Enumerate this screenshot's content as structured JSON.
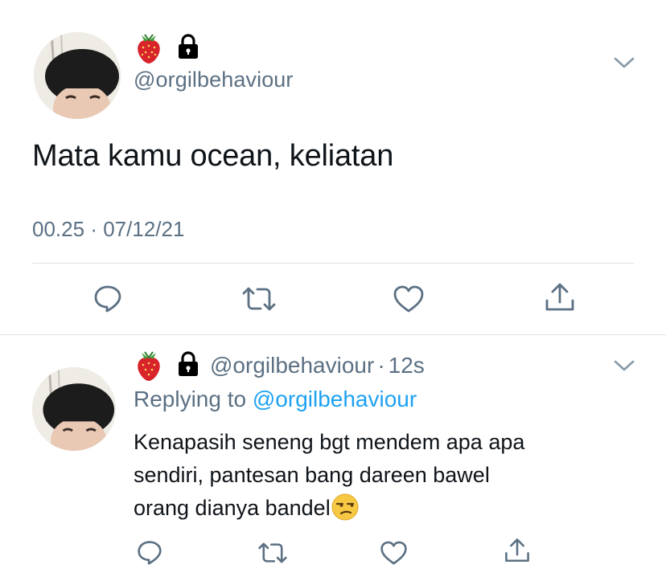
{
  "main_tweet": {
    "handle": "@orgilbehaviour",
    "text": "Mata kamu ocean, keliatan",
    "time": "00.25",
    "separator": "·",
    "date": "07/12/21"
  },
  "reply_tweet": {
    "handle": "@orgilbehaviour",
    "separator": "·",
    "age": "12s",
    "replying_prefix": "Replying to",
    "replying_to": "@orgilbehaviour",
    "text_lines": [
      "Kenapasih seneng bgt mendem apa apa",
      "sendiri, pantesan bang dareen bawel",
      "orang dianya bandel"
    ],
    "trailing_emoji": "unamused-face-emoji"
  },
  "icons": {
    "name_emoji": "strawberry-emoji",
    "protected": "lock-icon",
    "menu": "chevron-down-icon",
    "reply": "reply-bubble-icon",
    "retweet": "retweet-icon",
    "like": "heart-icon",
    "share": "share-icon"
  },
  "colors": {
    "text": "#0f1419",
    "secondary": "#5b7083",
    "link": "#1da1f2",
    "divider": "#dde3e7",
    "strawberry": "#d8232a"
  }
}
